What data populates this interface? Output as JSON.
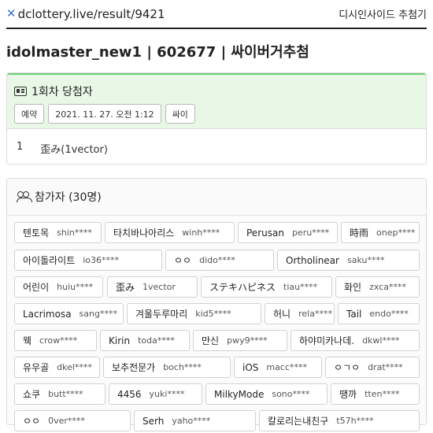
{
  "header": {
    "site": "dclottery.live/result/9421",
    "service": "디시인사이드 추첨기"
  },
  "title": "idolmaster_new1 | 602677 | 싸이버거추첨",
  "winners": {
    "title": "1회차 당첨자",
    "tags": [
      "예약",
      "2021. 11. 27. 오전 1:12",
      "싸이"
    ],
    "list": [
      {
        "rank": "1",
        "name": "歪み(1vector)"
      }
    ]
  },
  "participants": {
    "title": "참가자 (30명)",
    "items": [
      {
        "name": "텐토목",
        "user": "shin****"
      },
      {
        "name": "타치바나아리스",
        "user": "winh****"
      },
      {
        "name": "Perusan",
        "user": "peru****"
      },
      {
        "name": "時雨",
        "user": "onep****"
      },
      {
        "name": "아이돌라이트",
        "user": "io36****"
      },
      {
        "name": "ㅇㅇ",
        "user": "dido****"
      },
      {
        "name": "Ortholinear",
        "user": "saku****"
      },
      {
        "name": "어린이",
        "user": "huiu****"
      },
      {
        "name": "歪み",
        "user": "1vector"
      },
      {
        "name": "ステキハピネス",
        "user": "tiau****"
      },
      {
        "name": "화인",
        "user": "zxca****"
      },
      {
        "name": "Lacrimosa",
        "user": "sang****"
      },
      {
        "name": "겨울두루마리",
        "user": "kid5****"
      },
      {
        "name": "허니",
        "user": "rela****"
      },
      {
        "name": "Tail",
        "user": "endo****"
      },
      {
        "name": "웩",
        "user": "crow****"
      },
      {
        "name": "Kirin",
        "user": "toda****"
      },
      {
        "name": "만신",
        "user": "pwy9****"
      },
      {
        "name": "하야미카나데.",
        "user": "dkwl****"
      },
      {
        "name": "유우골",
        "user": "dkel****"
      },
      {
        "name": "보추전문가",
        "user": "boch****"
      },
      {
        "name": "iOS",
        "user": "macc****"
      },
      {
        "name": "ㅇㄱㅇ",
        "user": "drat****"
      },
      {
        "name": "쇼쿠",
        "user": "butt****"
      },
      {
        "name": "4456",
        "user": "yuki****"
      },
      {
        "name": "MilkyMode",
        "user": "sono****"
      },
      {
        "name": "땡까",
        "user": "tten****"
      },
      {
        "name": "ㅇㅇ",
        "user": "0ver****"
      },
      {
        "name": "Serh",
        "user": "yaho****"
      },
      {
        "name": "칼로리는내친구",
        "user": "t57h****"
      }
    ]
  }
}
